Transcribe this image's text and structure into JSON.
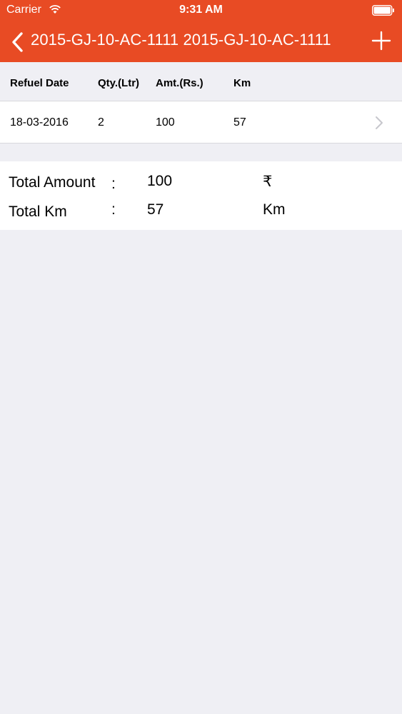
{
  "status_bar": {
    "carrier": "Carrier",
    "time": "9:31 AM"
  },
  "nav": {
    "title": "2015-GJ-10-AC-1111 2015-GJ-10-AC-1111"
  },
  "colors": {
    "accent": "#e84b24",
    "background": "#efeff4"
  },
  "table": {
    "headers": [
      "Refuel Date",
      "Qty.(Ltr)",
      "Amt.(Rs.)",
      "Km"
    ],
    "rows": [
      {
        "date": "18-03-2016",
        "qty": "2",
        "amount": "100",
        "km": "57"
      }
    ]
  },
  "summary": {
    "total_amount": {
      "label": "Total Amount",
      "colon": ":",
      "value": "100",
      "unit": "₹"
    },
    "total_km": {
      "label": "Total Km",
      "colon": ":",
      "value": "57",
      "unit": "Km"
    }
  }
}
